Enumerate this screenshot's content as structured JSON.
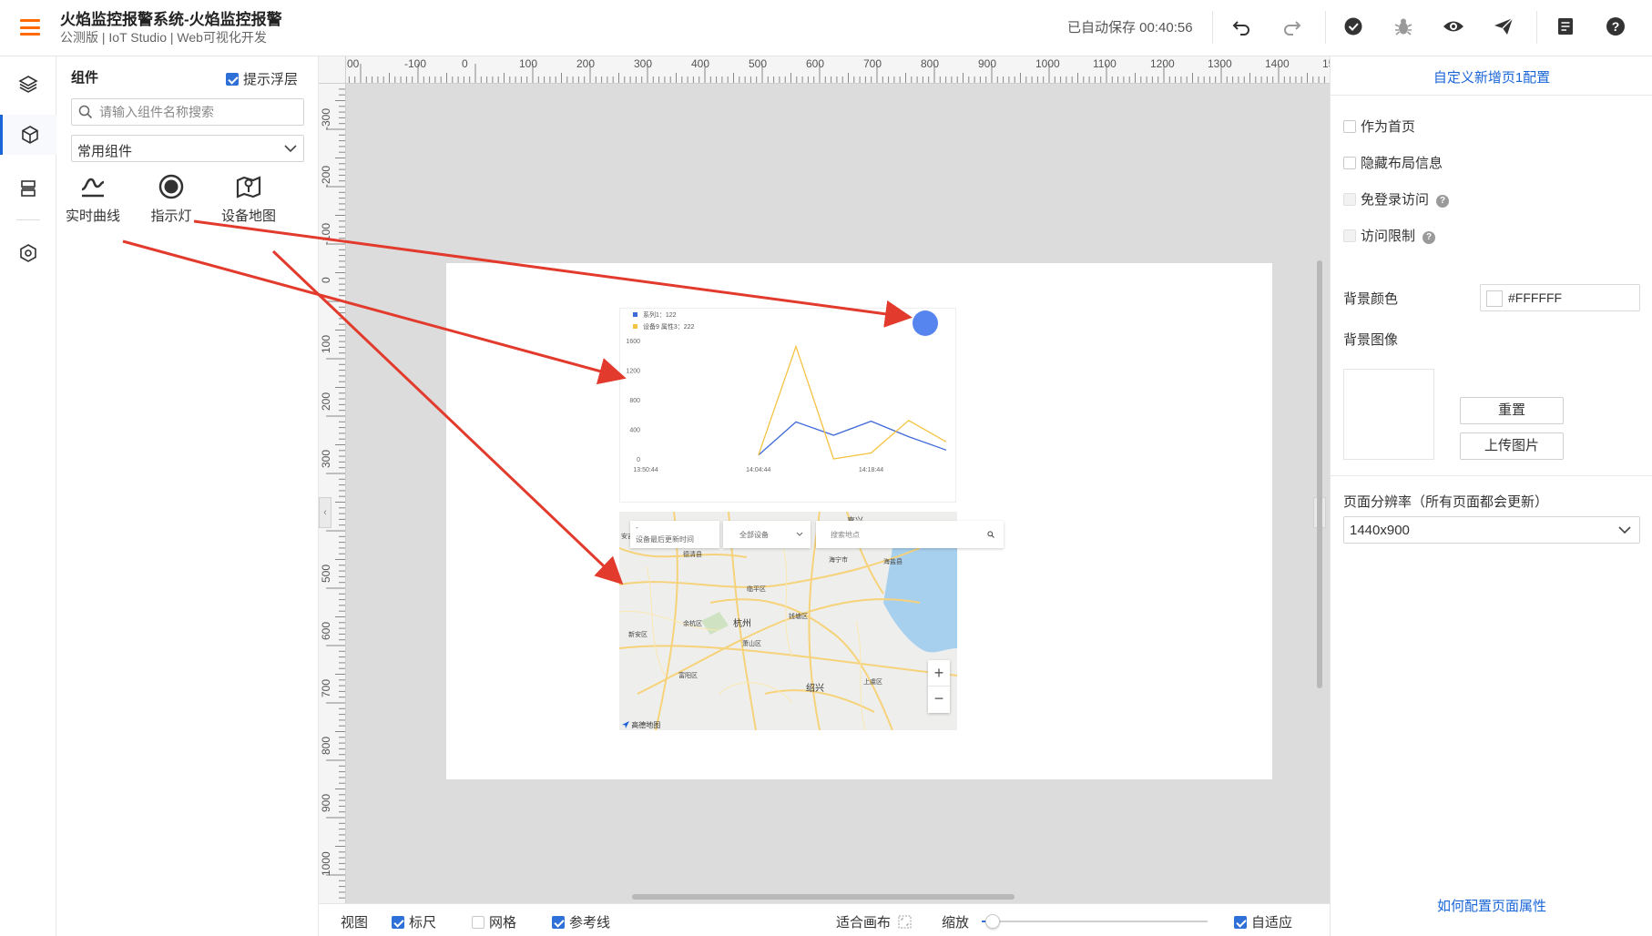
{
  "header": {
    "title": "火焰监控报警系统-火焰监控报警",
    "subtitle": "公测版 | IoT Studio | Web可视化开发",
    "autosave": "已自动保存 00:40:56",
    "icons": [
      "undo-icon",
      "redo-icon",
      "check-circle-icon",
      "bug-icon",
      "eye-icon",
      "send-icon",
      "document-icon",
      "help-icon"
    ],
    "accent_color": "#ff6a00"
  },
  "left_nav": {
    "icons": [
      "layers-icon",
      "cube-icon",
      "rows-icon",
      "hexagon-settings-icon"
    ]
  },
  "components_panel": {
    "title": "组件",
    "float_tip_label": "提示浮层",
    "float_tip_checked": true,
    "search_placeholder": "请输入组件名称搜索",
    "category": "常用组件",
    "items": [
      {
        "label": "实时曲线",
        "icon": "realtime-curve-icon"
      },
      {
        "label": "指示灯",
        "icon": "indicator-light-icon"
      },
      {
        "label": "设备地图",
        "icon": "device-map-icon"
      }
    ]
  },
  "ruler": {
    "h_labels": [
      "00",
      "-100",
      "0",
      "100",
      "200",
      "300",
      "400",
      "500",
      "600",
      "700",
      "800",
      "900",
      "1000",
      "1100",
      "1200",
      "1300",
      "1400",
      "150"
    ],
    "v_labels": [
      "-300",
      "-200",
      "-100",
      "0",
      "100",
      "200",
      "300",
      "400",
      "500",
      "600",
      "700",
      "800",
      "900",
      "1000"
    ]
  },
  "canvas": {
    "page_background": "#FFFFFF",
    "indicator_color": "#5685ef",
    "line_chart": {
      "legend": [
        {
          "name": "系列1：122",
          "color": "#3f6ad8"
        },
        {
          "name": "设备9 属性3：222",
          "color": "#f5c342"
        }
      ],
      "y_ticks": [
        "1600",
        "1200",
        "800",
        "400",
        "0"
      ],
      "x_ticks": [
        "13:50:44",
        "14:04:44",
        "14:18:44"
      ]
    },
    "map": {
      "last_update_label": "设备最后更新时间",
      "last_update_value": "-",
      "device_filter": "全部设备",
      "search_placeholder": "搜索地点",
      "zoom_in": "+",
      "zoom_out": "−",
      "logo": "高德地图",
      "places": [
        "嘉兴",
        "德清县",
        "海宁市",
        "临平区",
        "余杭区",
        "杭州",
        "钱塘区",
        "萧山区",
        "富阳区",
        "绍兴",
        "上虞区",
        "新安区",
        "海盐县",
        "安吉"
      ]
    }
  },
  "chart_data": {
    "type": "line",
    "x": [
      "13:50:44",
      "13:54:44",
      "13:57:44",
      "14:04:44",
      "14:11:44",
      "14:15:44",
      "14:18:44",
      "14:21:44",
      "14:28:44"
    ],
    "series": [
      {
        "name": "系列1：122",
        "values": [
          null,
          null,
          null,
          50,
          500,
          320,
          510,
          300,
          120
        ]
      },
      {
        "name": "设备9 属性3：222",
        "values": [
          null,
          null,
          null,
          50,
          1520,
          0,
          80,
          520,
          230
        ]
      }
    ],
    "yticks": [
      0,
      400,
      800,
      1200,
      1600
    ],
    "ylim": [
      0,
      1600
    ]
  },
  "statusbar": {
    "view_label": "视图",
    "ruler_label": "标尺",
    "ruler_checked": true,
    "grid_label": "网格",
    "grid_checked": false,
    "guide_label": "参考线",
    "guide_checked": true,
    "fit_canvas_label": "适合画布",
    "zoom_label": "缩放",
    "adaptive_label": "自适应",
    "adaptive_checked": true
  },
  "right_panel": {
    "title": "自定义新增页1配置",
    "set_home": "作为首页",
    "hide_layout": "隐藏布局信息",
    "no_login": "免登录访问",
    "access_limit": "访问限制",
    "bg_color_label": "背景颜色",
    "bg_color_value": "#FFFFFF",
    "bg_image_label": "背景图像",
    "reset_btn": "重置",
    "upload_btn": "上传图片",
    "resolution_label": "页面分辨率（所有页面都会更新）",
    "resolution_value": "1440x900",
    "help_link": "如何配置页面属性"
  }
}
